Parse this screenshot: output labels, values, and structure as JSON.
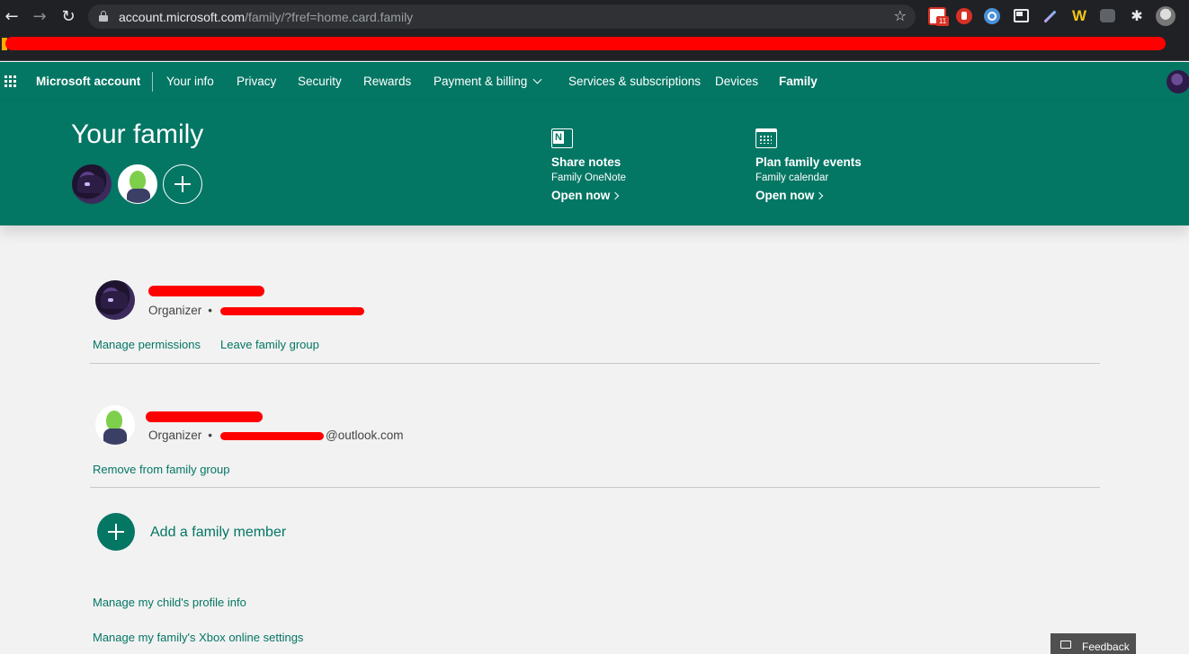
{
  "browser": {
    "url_host": "account.microsoft.com",
    "url_path": "/family/?fref=home.card.family",
    "gmail_badge": "11",
    "extension_icons": [
      "gmail-icon",
      "stop-icon",
      "search-extension-icon",
      "window-icon",
      "pen-icon",
      "w-extension-icon",
      "robot-icon",
      "puzzle-icon"
    ]
  },
  "nav": {
    "brand": "Microsoft account",
    "items": [
      "Your info",
      "Privacy",
      "Security",
      "Rewards",
      "Payment & billing",
      "Services & subscriptions",
      "Devices",
      "Family"
    ],
    "active": "Family"
  },
  "hero": {
    "title": "Your family",
    "cards": [
      {
        "title": "Share notes",
        "subtitle": "Family OneNote",
        "link": "Open now",
        "icon": "onenote-icon"
      },
      {
        "title": "Plan family events",
        "subtitle": "Family calendar",
        "link": "Open now",
        "icon": "calendar-icon"
      }
    ]
  },
  "members": [
    {
      "role": "Organizer",
      "email_tail": "",
      "links": [
        "Manage permissions",
        "Leave family group"
      ]
    },
    {
      "role": "Organizer",
      "email_tail": "@outlook.com",
      "links": [
        "Remove from family group"
      ]
    }
  ],
  "add_member": {
    "label": "Add a family member"
  },
  "bottom_links": [
    "Manage my child's profile info",
    "Manage my family's Xbox online settings"
  ],
  "feedback": {
    "label": "Feedback"
  },
  "colors": {
    "brand_green": "#047664",
    "redaction": "#ff0000",
    "chrome_dark": "#202124"
  }
}
